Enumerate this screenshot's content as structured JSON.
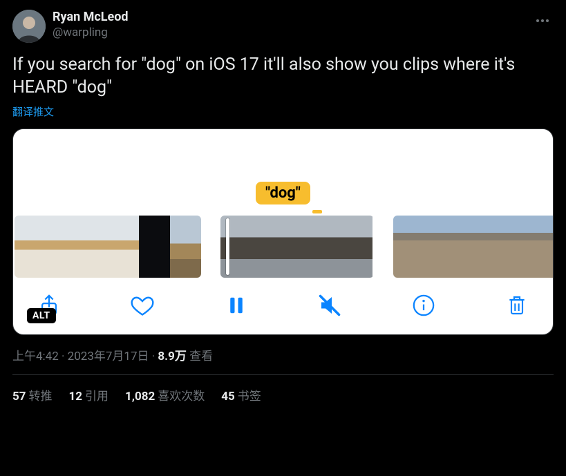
{
  "user": {
    "display_name": "Ryan McLeod",
    "handle": "@warpling"
  },
  "tweet_text": "If you search for \"dog\" on iOS 17 it'll also show you clips where it's HEARD \"dog\"",
  "translate_label": "翻译推文",
  "media": {
    "keyword_pill": "\"dog\"",
    "alt_badge": "ALT"
  },
  "meta": {
    "time": "上午4:42",
    "date": "2023年7月17日",
    "views_count": "8.9万",
    "views_label": "查看",
    "separator": " · "
  },
  "stats": {
    "retweets": {
      "count": "57",
      "label": "转推"
    },
    "quotes": {
      "count": "12",
      "label": "引用"
    },
    "likes": {
      "count": "1,082",
      "label": "喜欢次数"
    },
    "bookmarks": {
      "count": "45",
      "label": "书签"
    }
  }
}
